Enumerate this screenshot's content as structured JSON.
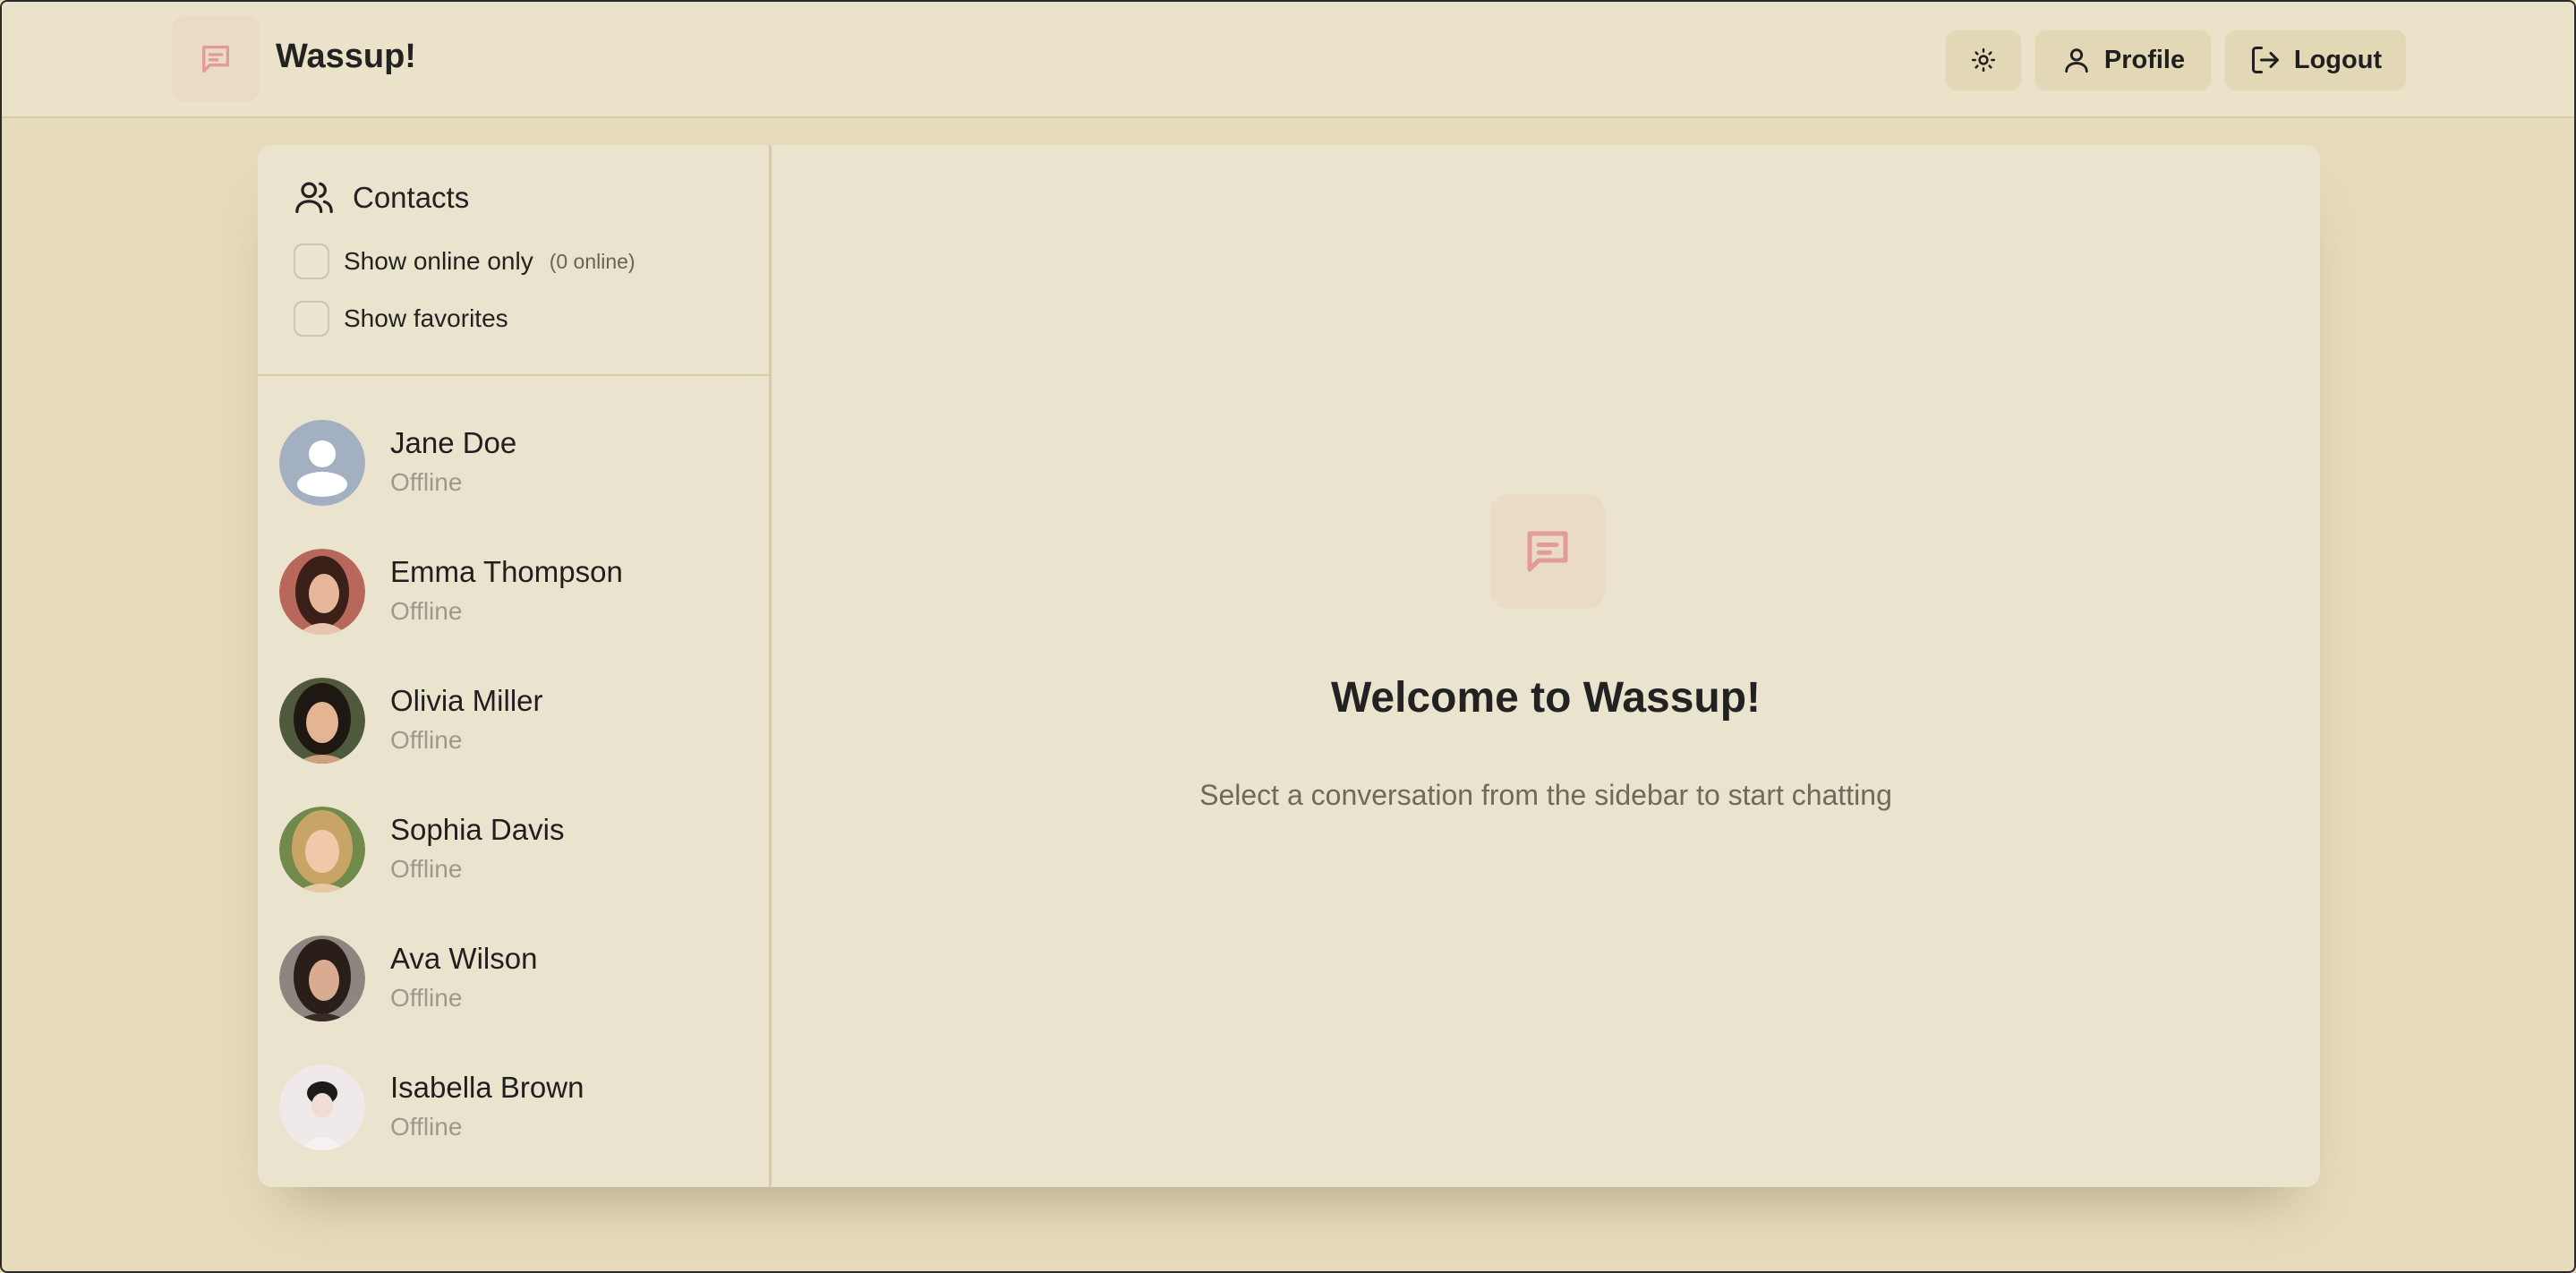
{
  "app": {
    "title": "Wassup!",
    "accent": "#e39a9a"
  },
  "header": {
    "theme_icon": "sun-icon",
    "profile_label": "Profile",
    "logout_label": "Logout"
  },
  "sidebar": {
    "title": "Contacts",
    "show_online_label": "Show online only",
    "online_count": "(0 online)",
    "show_favorites_label": "Show favorites",
    "contacts": [
      {
        "name": "Jane Doe",
        "status": "Offline",
        "avatar": "default-avatar"
      },
      {
        "name": "Emma Thompson",
        "status": "Offline",
        "avatar": "photo"
      },
      {
        "name": "Olivia Miller",
        "status": "Offline",
        "avatar": "photo"
      },
      {
        "name": "Sophia Davis",
        "status": "Offline",
        "avatar": "photo"
      },
      {
        "name": "Ava Wilson",
        "status": "Offline",
        "avatar": "photo"
      },
      {
        "name": "Isabella Brown",
        "status": "Offline",
        "avatar": "photo"
      }
    ]
  },
  "main": {
    "welcome_title": "Welcome to Wassup!",
    "welcome_subtitle": "Select a conversation from the sidebar to start chatting"
  }
}
